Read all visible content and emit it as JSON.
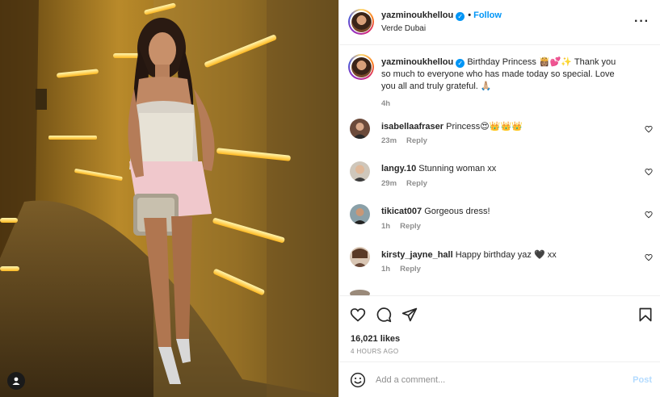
{
  "post": {
    "username": "yazminoukhellou",
    "verified": true,
    "follow_label": "Follow",
    "separator": "•",
    "location": "Verde Dubai",
    "more_icon": "more-horizontal-icon"
  },
  "caption": {
    "username": "yazminoukhellou",
    "text": "Birthday Princess 👸🏽💕✨ Thank you so much to everyone who has made today so special. Love you all and truly grateful. 🙏🏼",
    "time": "4h"
  },
  "comments": [
    {
      "username": "isabellaafraser",
      "text": "Princess😍👑👑👑",
      "time": "23m",
      "reply_label": "Reply"
    },
    {
      "username": "langy.10",
      "text": "Stunning woman xx",
      "time": "29m",
      "reply_label": "Reply"
    },
    {
      "username": "tikicat007",
      "text": "Gorgeous dress!",
      "time": "1h",
      "reply_label": "Reply"
    },
    {
      "username": "kirsty_jayne_hall",
      "text": "Happy birthday yaz 🖤 xx",
      "time": "1h",
      "reply_label": "Reply"
    }
  ],
  "actions": {
    "likes": "16,021 likes",
    "time_ago": "4 HOURS AGO",
    "icons": [
      "heart-icon",
      "comment-icon",
      "share-icon",
      "bookmark-icon"
    ]
  },
  "composer": {
    "placeholder": "Add a comment...",
    "post_label": "Post"
  },
  "colors": {
    "accent": "#0095f6",
    "post_disabled": "#b3dbff",
    "muted": "#8e8e8e"
  }
}
